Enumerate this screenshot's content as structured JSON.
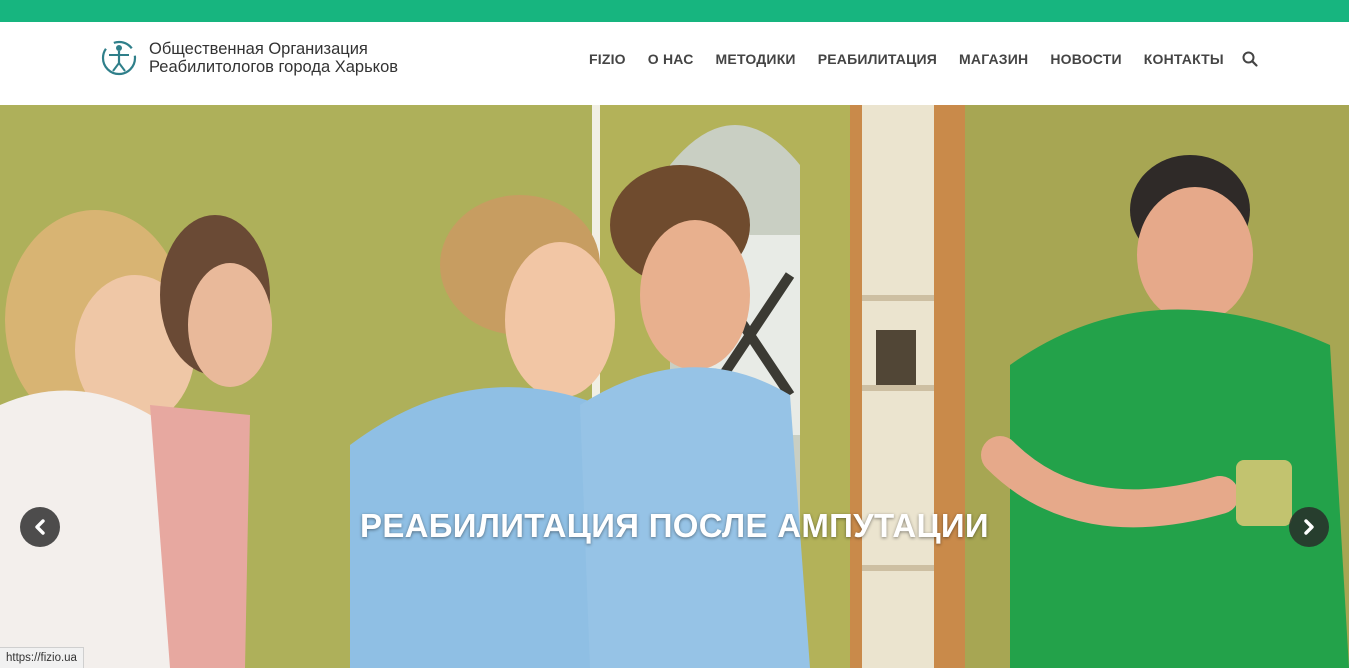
{
  "brand": {
    "name_line1": "Общественная Организация",
    "name_line2": "Реабилитологов города Харьков",
    "accent": "#17b57f"
  },
  "nav": {
    "items": [
      {
        "label": "FIZIO"
      },
      {
        "label": "О НАС"
      },
      {
        "label": "МЕТОДИКИ"
      },
      {
        "label": "РЕАБИЛИТАЦИЯ"
      },
      {
        "label": "МАГАЗИН"
      },
      {
        "label": "НОВОСТИ"
      },
      {
        "label": "КОНТАКТЫ"
      }
    ],
    "search_icon": "search-icon"
  },
  "slider": {
    "caption": "РЕАБИЛИТАЦИЯ ПОСЛЕ АМПУТАЦИИ",
    "prev_icon": "chevron-left-icon",
    "next_icon": "chevron-right-icon"
  },
  "status_bar": {
    "url": "https://fizio.ua"
  }
}
